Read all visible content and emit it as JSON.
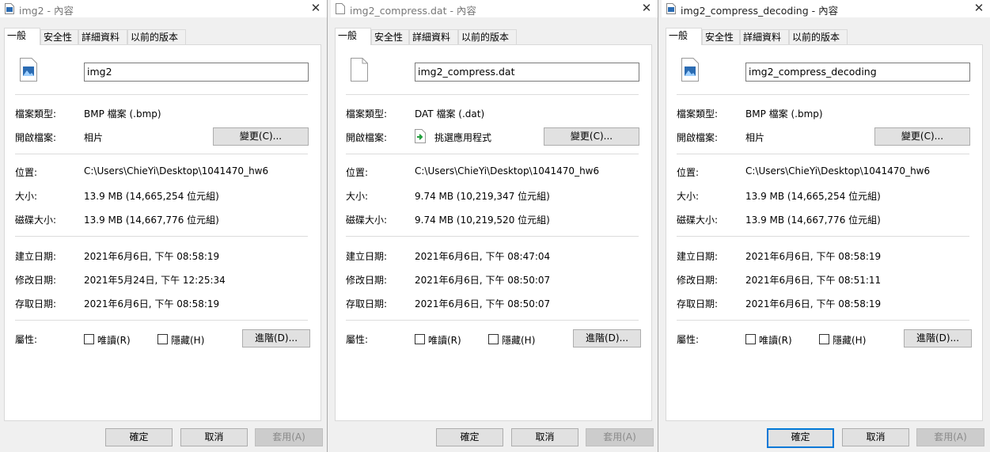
{
  "tabs": [
    "一般",
    "安全性",
    "詳細資料",
    "以前的版本"
  ],
  "labels": {
    "file_type": "檔案類型:",
    "open_with": "開啟檔案:",
    "location": "位置:",
    "size": "大小:",
    "size_on_disk": "磁碟大小:",
    "created": "建立日期:",
    "modified": "修改日期:",
    "accessed": "存取日期:",
    "attributes": "屬性:"
  },
  "buttons": {
    "change": "變更(C)...",
    "advanced": "進階(D)...",
    "ok": "確定",
    "cancel": "取消",
    "apply": "套用(A)"
  },
  "checkboxes": {
    "readonly": "唯讀(R)",
    "hidden": "隱藏(H)"
  },
  "close_glyph": "✕",
  "dialogs": [
    {
      "title": "img2 - 內容",
      "name": "img2",
      "file_type": "BMP 檔案 (.bmp)",
      "open_with": "相片",
      "location": "C:\\Users\\ChieYi\\Desktop\\1041470_hw6",
      "size": "13.9 MB (14,665,254 位元組)",
      "size_on_disk": "13.9 MB (14,667,776 位元組)",
      "created": "2021年6月6日, 下午 08:58:19",
      "modified": "2021年5月24日, 下午 12:25:34",
      "accessed": "2021年6月6日, 下午 08:58:19"
    },
    {
      "title": "img2_compress.dat - 內容",
      "name": "img2_compress.dat",
      "file_type": "DAT 檔案 (.dat)",
      "open_with": "挑選應用程式",
      "location": "C:\\Users\\ChieYi\\Desktop\\1041470_hw6",
      "size": "9.74 MB (10,219,347 位元組)",
      "size_on_disk": "9.74 MB (10,219,520 位元組)",
      "created": "2021年6月6日, 下午 08:47:04",
      "modified": "2021年6月6日, 下午 08:50:07",
      "accessed": "2021年6月6日, 下午 08:50:07"
    },
    {
      "title": "img2_compress_decoding - 內容",
      "name": "img2_compress_decoding",
      "file_type": "BMP 檔案 (.bmp)",
      "open_with": "相片",
      "location": "C:\\Users\\ChieYi\\Desktop\\1041470_hw6",
      "size": "13.9 MB (14,665,254 位元組)",
      "size_on_disk": "13.9 MB (14,667,776 位元組)",
      "created": "2021年6月6日, 下午 08:58:19",
      "modified": "2021年6月6日, 下午 08:51:11",
      "accessed": "2021年6月6日, 下午 08:58:19"
    }
  ]
}
